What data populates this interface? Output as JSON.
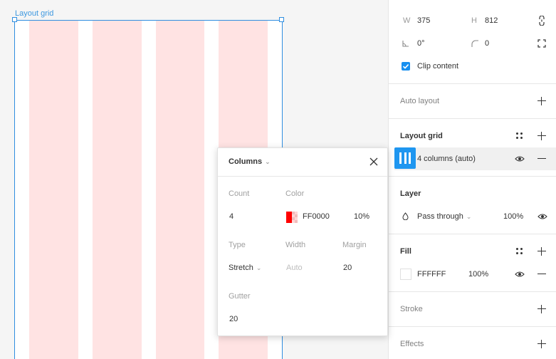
{
  "canvas": {
    "frame_label": "Layout grid",
    "columns_count": 4
  },
  "panel": {
    "w_label": "W",
    "w_value": "375",
    "h_label": "H",
    "h_value": "812",
    "rotation_value": "0°",
    "radius_value": "0",
    "clip_content_label": "Clip content",
    "clip_content_checked": true,
    "auto_layout_title": "Auto layout",
    "layout_grid_title": "Layout grid",
    "layout_grid_item": "4 columns (auto)",
    "layer_title": "Layer",
    "blend_mode": "Pass through",
    "layer_opacity": "100%",
    "fill_title": "Fill",
    "fill_hex": "FFFFFF",
    "fill_opacity": "100%",
    "stroke_title": "Stroke",
    "effects_title": "Effects"
  },
  "popover": {
    "title": "Columns",
    "count_label": "Count",
    "count_value": "4",
    "color_label": "Color",
    "color_hex": "FF0000",
    "color_opacity": "10%",
    "type_label": "Type",
    "type_value": "Stretch",
    "width_label": "Width",
    "width_placeholder": "Auto",
    "margin_label": "Margin",
    "margin_value": "20",
    "gutter_label": "Gutter",
    "gutter_value": "20"
  },
  "colors": {
    "accent": "#1e96f0",
    "selection": "#2f8ee0",
    "grid_column": "#ffe3e3",
    "grid_color": "#ff0000"
  }
}
